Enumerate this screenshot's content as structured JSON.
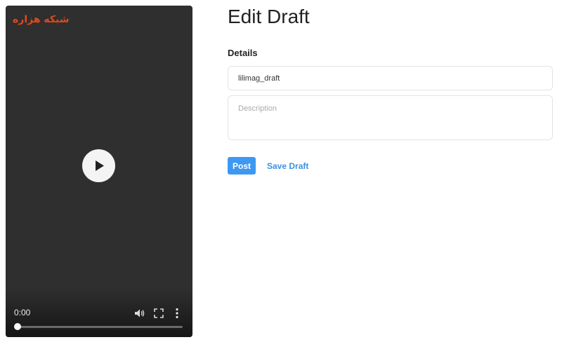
{
  "player": {
    "watermark_text": "شبکه هزاره",
    "current_time": "0:00",
    "progress_fraction": 0.0,
    "icons": [
      "play-icon",
      "volume-icon",
      "fullscreen-icon",
      "more-vertical-icon"
    ],
    "watermark_color": "#e3481c",
    "background_color": "#2f2f2f"
  },
  "form": {
    "title": "Edit Draft",
    "section_label": "Details",
    "title_value": "lilimag_draft",
    "description_placeholder": "Description",
    "description_value": "",
    "post_label": "Post",
    "save_draft_label": "Save Draft",
    "accent_color": "#3d98f2"
  }
}
